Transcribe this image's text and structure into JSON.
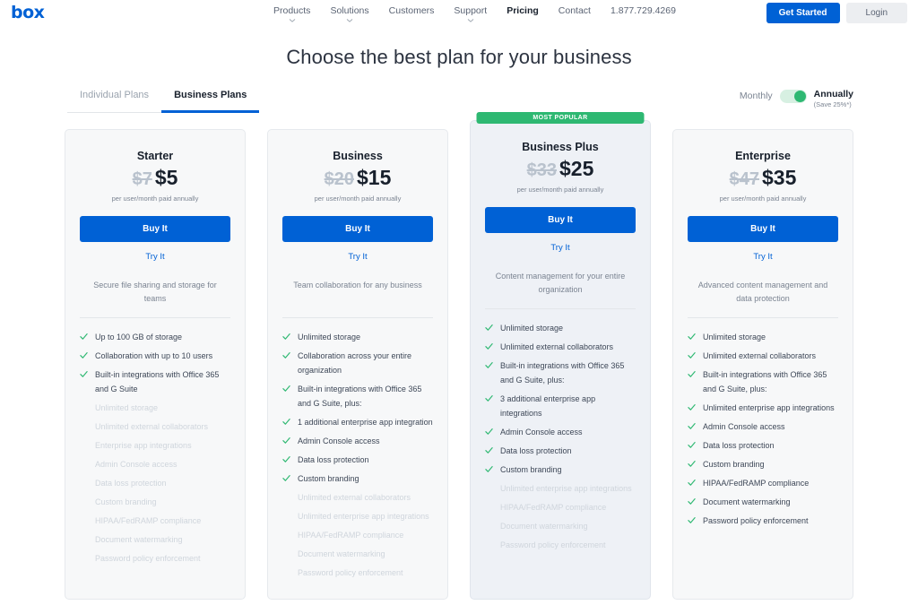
{
  "header": {
    "logo": "box",
    "nav": [
      {
        "label": "Products",
        "active": false,
        "chevron": true
      },
      {
        "label": "Solutions",
        "active": false,
        "chevron": true
      },
      {
        "label": "Customers",
        "active": false,
        "chevron": false
      },
      {
        "label": "Support",
        "active": false,
        "chevron": true
      },
      {
        "label": "Pricing",
        "active": true,
        "chevron": false
      },
      {
        "label": "Contact",
        "active": false,
        "chevron": false
      },
      {
        "label": "1.877.729.4269",
        "active": false,
        "chevron": false
      }
    ],
    "get_started_label": "Get Started",
    "login_label": "Login"
  },
  "page_title": "Choose the best plan for your business",
  "tabs": [
    {
      "label": "Individual Plans",
      "active": false
    },
    {
      "label": "Business Plans",
      "active": true
    }
  ],
  "billing_toggle": {
    "left_label": "Monthly",
    "right_label": "Annually",
    "save_note": "(Save 25%*)",
    "selected": "Annually",
    "accent_color": "#2eb872"
  },
  "colors": {
    "brand_blue": "#0061d5",
    "green": "#2eb872",
    "muted": "#cfd5dc"
  },
  "plans": [
    {
      "name": "Starter",
      "badge": null,
      "price_old": "$7",
      "price_new": "$5",
      "price_note": "per user/month paid annually",
      "buy_label": "Buy It",
      "try_label": "Try It",
      "tagline": "Secure file sharing and storage for teams",
      "features": [
        {
          "label": "Up to 100 GB of storage",
          "included": true
        },
        {
          "label": "Collaboration with up to 10 users",
          "included": true
        },
        {
          "label": "Built-in integrations with Office 365 and G Suite",
          "included": true
        },
        {
          "label": "Unlimited storage",
          "included": false
        },
        {
          "label": "Unlimited external collaborators",
          "included": false
        },
        {
          "label": "Enterprise app integrations",
          "included": false
        },
        {
          "label": "Admin Console access",
          "included": false
        },
        {
          "label": "Data loss protection",
          "included": false
        },
        {
          "label": "Custom branding",
          "included": false
        },
        {
          "label": "HIPAA/FedRAMP compliance",
          "included": false
        },
        {
          "label": "Document watermarking",
          "included": false
        },
        {
          "label": "Password policy enforcement",
          "included": false
        }
      ]
    },
    {
      "name": "Business",
      "badge": null,
      "price_old": "$20",
      "price_new": "$15",
      "price_note": "per user/month paid annually",
      "buy_label": "Buy It",
      "try_label": "Try It",
      "tagline": "Team collaboration for any business",
      "features": [
        {
          "label": "Unlimited storage",
          "included": true
        },
        {
          "label": "Collaboration across your entire organization",
          "included": true
        },
        {
          "label": "Built-in integrations with Office 365 and G Suite, plus:",
          "included": true
        },
        {
          "label": "1 additional enterprise app integration",
          "included": true
        },
        {
          "label": "Admin Console access",
          "included": true
        },
        {
          "label": "Data loss protection",
          "included": true
        },
        {
          "label": "Custom branding",
          "included": true
        },
        {
          "label": "Unlimited external collaborators",
          "included": false
        },
        {
          "label": "Unlimited enterprise app integrations",
          "included": false
        },
        {
          "label": "HIPAA/FedRAMP compliance",
          "included": false
        },
        {
          "label": "Document watermarking",
          "included": false
        },
        {
          "label": "Password policy enforcement",
          "included": false
        }
      ]
    },
    {
      "name": "Business Plus",
      "badge": "MOST POPULAR",
      "price_old": "$33",
      "price_new": "$25",
      "price_note": "per user/month paid annually",
      "buy_label": "Buy It",
      "try_label": "Try It",
      "tagline": "Content management for your entire organization",
      "features": [
        {
          "label": "Unlimited storage",
          "included": true
        },
        {
          "label": "Unlimited external collaborators",
          "included": true
        },
        {
          "label": "Built-in integrations with Office 365 and G Suite, plus:",
          "included": true
        },
        {
          "label": "3 additional enterprise app integrations",
          "included": true
        },
        {
          "label": "Admin Console access",
          "included": true
        },
        {
          "label": "Data loss protection",
          "included": true
        },
        {
          "label": "Custom branding",
          "included": true
        },
        {
          "label": "Unlimited enterprise app integrations",
          "included": false
        },
        {
          "label": "HIPAA/FedRAMP compliance",
          "included": false
        },
        {
          "label": "Document watermarking",
          "included": false
        },
        {
          "label": "Password policy enforcement",
          "included": false
        }
      ]
    },
    {
      "name": "Enterprise",
      "badge": null,
      "price_old": "$47",
      "price_new": "$35",
      "price_note": "per user/month paid annually",
      "buy_label": "Buy It",
      "try_label": "Try It",
      "tagline": "Advanced content management and data protection",
      "features": [
        {
          "label": "Unlimited storage",
          "included": true
        },
        {
          "label": "Unlimited external collaborators",
          "included": true
        },
        {
          "label": "Built-in integrations with Office 365 and G Suite, plus:",
          "included": true
        },
        {
          "label": "Unlimited enterprise app integrations",
          "included": true
        },
        {
          "label": "Admin Console access",
          "included": true
        },
        {
          "label": "Data loss protection",
          "included": true
        },
        {
          "label": "Custom branding",
          "included": true
        },
        {
          "label": "HIPAA/FedRAMP compliance",
          "included": true
        },
        {
          "label": "Document watermarking",
          "included": true
        },
        {
          "label": "Password policy enforcement",
          "included": true
        }
      ]
    }
  ]
}
